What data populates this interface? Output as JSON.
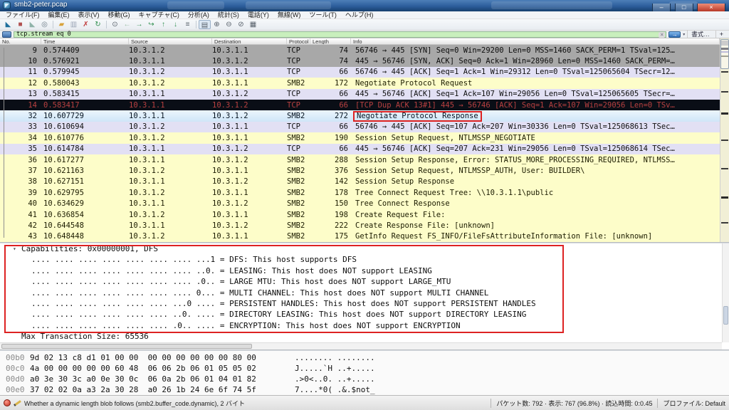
{
  "window": {
    "title": "smb2-peter.pcap",
    "controls": {
      "minimize": "–",
      "maximize": "□",
      "close": "×"
    }
  },
  "menu": {
    "items": [
      {
        "name": "file",
        "label": "ファイル(F)"
      },
      {
        "name": "edit",
        "label": "編集(E)"
      },
      {
        "name": "view",
        "label": "表示(V)"
      },
      {
        "name": "go",
        "label": "移動(G)"
      },
      {
        "name": "capture",
        "label": "キャプチャ(C)"
      },
      {
        "name": "analyze",
        "label": "分析(A)"
      },
      {
        "name": "statistics",
        "label": "統計(S)"
      },
      {
        "name": "telephony",
        "label": "電話(Y)"
      },
      {
        "name": "wireless",
        "label": "無線(W)"
      },
      {
        "name": "tools",
        "label": "ツール(T)"
      },
      {
        "name": "help",
        "label": "ヘルプ(H)"
      }
    ]
  },
  "toolbar": {
    "icons": [
      {
        "name": "start-capture",
        "glyph": "◣",
        "color": "#1e6f9c"
      },
      {
        "name": "stop-capture",
        "glyph": "■",
        "color": "#b05050"
      },
      {
        "name": "restart-capture",
        "glyph": "◣",
        "color": "#8fb3a9"
      },
      {
        "name": "capture-options",
        "glyph": "◎",
        "color": "#6a7a85"
      },
      {
        "sep": true
      },
      {
        "name": "open-file",
        "glyph": "▰",
        "color": "#d8a33c"
      },
      {
        "name": "save-file",
        "glyph": "▥",
        "color": "#9aa4b5"
      },
      {
        "name": "close-file",
        "glyph": "✗",
        "color": "#c03a3a"
      },
      {
        "name": "reload-file",
        "glyph": "↻",
        "color": "#2f8f4e"
      },
      {
        "sep": true
      },
      {
        "name": "find-packet",
        "glyph": "⊙",
        "color": "#57606a"
      },
      {
        "name": "go-back",
        "glyph": "←",
        "color": "#9fc0a8"
      },
      {
        "name": "go-forward",
        "glyph": "→",
        "color": "#2f8f4e"
      },
      {
        "name": "go-to-packet",
        "glyph": "↪",
        "color": "#2f8f4e"
      },
      {
        "name": "go-first",
        "glyph": "↑",
        "color": "#2f8f4e"
      },
      {
        "name": "go-last",
        "glyph": "↓",
        "color": "#2f8f4e"
      },
      {
        "name": "auto-scroll",
        "glyph": "≡",
        "color": "#57606a"
      },
      {
        "sep": true
      },
      {
        "name": "colorize",
        "glyph": "▤",
        "color": "#57606a",
        "framed": true
      },
      {
        "name": "zoom-in",
        "glyph": "⊕",
        "color": "#57606a"
      },
      {
        "name": "zoom-out",
        "glyph": "⊖",
        "color": "#57606a"
      },
      {
        "name": "zoom-100",
        "glyph": "⊘",
        "color": "#57606a"
      },
      {
        "name": "resize-columns",
        "glyph": "▦",
        "color": "#57606a"
      }
    ]
  },
  "filter": {
    "value": "tcp.stream eq 0",
    "clear_glyph": "×",
    "apply_glyph": "→",
    "caret_glyph": "▾",
    "expression_label": "書式…",
    "add_label": "+"
  },
  "packet_list": {
    "columns": [
      "No.",
      "Time",
      "Source",
      "Destination",
      "Protocol",
      "Length",
      "Info"
    ],
    "rows": [
      {
        "no": "9",
        "time": "0.574409",
        "src": "10.3.1.2",
        "dst": "10.3.1.1",
        "proto": "TCP",
        "len": "74",
        "info": "56746 → 445 [SYN] Seq=0 Win=29200 Len=0 MSS=1460 SACK_PERM=1 TSval=125…",
        "style": "gray"
      },
      {
        "no": "10",
        "time": "0.576921",
        "src": "10.3.1.1",
        "dst": "10.3.1.2",
        "proto": "TCP",
        "len": "74",
        "info": "445 → 56746 [SYN, ACK] Seq=0 Ack=1 Win=28960 Len=0 MSS=1460 SACK_PERM=…",
        "style": "gray"
      },
      {
        "no": "11",
        "time": "0.579945",
        "src": "10.3.1.2",
        "dst": "10.3.1.1",
        "proto": "TCP",
        "len": "66",
        "info": "56746 → 445 [ACK] Seq=1 Ack=1 Win=29312 Len=0 TSval=125065604 TSecr=12…",
        "style": "lavender"
      },
      {
        "no": "12",
        "time": "0.580043",
        "src": "10.3.1.2",
        "dst": "10.3.1.1",
        "proto": "SMB2",
        "len": "172",
        "info": "Negotiate Protocol Request",
        "style": "yellow"
      },
      {
        "no": "13",
        "time": "0.583415",
        "src": "10.3.1.1",
        "dst": "10.3.1.2",
        "proto": "TCP",
        "len": "66",
        "info": "445 → 56746 [ACK] Seq=1 Ack=107 Win=29056 Len=0 TSval=125065605 TSecr=…",
        "style": "lavender"
      },
      {
        "no": "14",
        "time": "0.583417",
        "src": "10.3.1.1",
        "dst": "10.3.1.2",
        "proto": "TCP",
        "len": "66",
        "info": "[TCP Dup ACK 13#1] 445 → 56746 [ACK] Seq=1 Ack=107 Win=29056 Len=0 TSv…",
        "style": "badtcp"
      },
      {
        "no": "32",
        "time": "10.607729",
        "src": "10.3.1.1",
        "dst": "10.3.1.2",
        "proto": "SMB2",
        "len": "272",
        "info": "Negotiate Protocol Response",
        "style": "selected",
        "boxed": true
      },
      {
        "no": "33",
        "time": "10.610694",
        "src": "10.3.1.2",
        "dst": "10.3.1.1",
        "proto": "TCP",
        "len": "66",
        "info": "56746 → 445 [ACK] Seq=107 Ack=207 Win=30336 Len=0 TSval=125068613 TSec…",
        "style": "lavender"
      },
      {
        "no": "34",
        "time": "10.610776",
        "src": "10.3.1.2",
        "dst": "10.3.1.1",
        "proto": "SMB2",
        "len": "190",
        "info": "Session Setup Request, NTLMSSP_NEGOTIATE",
        "style": "yellow"
      },
      {
        "no": "35",
        "time": "10.614784",
        "src": "10.3.1.1",
        "dst": "10.3.1.2",
        "proto": "TCP",
        "len": "66",
        "info": "445 → 56746 [ACK] Seq=207 Ack=231 Win=29056 Len=0 TSval=125068614 TSec…",
        "style": "lavender"
      },
      {
        "no": "36",
        "time": "10.617277",
        "src": "10.3.1.1",
        "dst": "10.3.1.2",
        "proto": "SMB2",
        "len": "288",
        "info": "Session Setup Response, Error: STATUS_MORE_PROCESSING_REQUIRED, NTLMSS…",
        "style": "yellow"
      },
      {
        "no": "37",
        "time": "10.621163",
        "src": "10.3.1.2",
        "dst": "10.3.1.1",
        "proto": "SMB2",
        "len": "376",
        "info": "Session Setup Request, NTLMSSP_AUTH, User: BUILDER\\",
        "style": "yellow"
      },
      {
        "no": "38",
        "time": "10.627151",
        "src": "10.3.1.1",
        "dst": "10.3.1.2",
        "proto": "SMB2",
        "len": "142",
        "info": "Session Setup Response",
        "style": "yellow"
      },
      {
        "no": "39",
        "time": "10.629795",
        "src": "10.3.1.2",
        "dst": "10.3.1.1",
        "proto": "SMB2",
        "len": "178",
        "info": "Tree Connect Request Tree: \\\\10.3.1.1\\public",
        "style": "yellow"
      },
      {
        "no": "40",
        "time": "10.634629",
        "src": "10.3.1.1",
        "dst": "10.3.1.2",
        "proto": "SMB2",
        "len": "150",
        "info": "Tree Connect Response",
        "style": "yellow"
      },
      {
        "no": "41",
        "time": "10.636854",
        "src": "10.3.1.2",
        "dst": "10.3.1.1",
        "proto": "SMB2",
        "len": "198",
        "info": "Create Request File:",
        "style": "yellow"
      },
      {
        "no": "42",
        "time": "10.644548",
        "src": "10.3.1.1",
        "dst": "10.3.1.2",
        "proto": "SMB2",
        "len": "222",
        "info": "Create Response File: [unknown]",
        "style": "yellow"
      },
      {
        "no": "43",
        "time": "10.648448",
        "src": "10.3.1.2",
        "dst": "10.3.1.1",
        "proto": "SMB2",
        "len": "175",
        "info": "GetInfo Request FS_INFO/FileFsAttributeInformation File: [unknown]",
        "style": "yellow"
      }
    ]
  },
  "details": {
    "expander_glyph": "▾",
    "capabilities_header": "Capabilities: 0x00000001, DFS",
    "flags": [
      ".... .... .... .... .... .... .... ...1 = DFS: This host supports DFS",
      ".... .... .... .... .... .... .... ..0. = LEASING: This host does NOT support LEASING",
      ".... .... .... .... .... .... .... .0.. = LARGE MTU: This host does NOT support LARGE_MTU",
      ".... .... .... .... .... .... .... 0... = MULTI CHANNEL: This host does NOT support MULTI CHANNEL",
      ".... .... .... .... .... .... ...0 .... = PERSISTENT HANDLES: This host does NOT support PERSISTENT HANDLES",
      ".... .... .... .... .... .... ..0. .... = DIRECTORY LEASING: This host does NOT support DIRECTORY LEASING",
      ".... .... .... .... .... .... .0.. .... = ENCRYPTION: This host does NOT support ENCRYPTION"
    ],
    "max_transaction": "Max Transaction Size: 65536"
  },
  "hex": {
    "rows": [
      {
        "offset": "00b0",
        "bytes": "9d 02 13 c8 d1 01 00 00  00 00 00 00 00 00 80 00",
        "ascii": "........ ........"
      },
      {
        "offset": "00c0",
        "bytes": "4a 00 00 00 00 00 60 48  06 06 2b 06 01 05 05 02",
        "ascii": "J.....`H ..+....."
      },
      {
        "offset": "00d0",
        "bytes": "a0 3e 30 3c a0 0e 30 0c  06 0a 2b 06 01 04 01 82",
        "ascii": ".>0<..0. ..+....."
      },
      {
        "offset": "00e0",
        "bytes": "37 02 02 0a a3 2a 30 28  a0 26 1b 24 6e 6f 74 5f",
        "ascii": "7....*0( .&.$not_"
      }
    ]
  },
  "statusbar": {
    "field_info": "Whether a dynamic length blob follows (smb2.buffer_code.dynamic), 2 バイト",
    "packets_info": "パケット数: 792 · 表示: 767 (96.8%) · 読込時間: 0:0.45",
    "profile": "プロファイル: Default"
  },
  "colors": {
    "annotation_red": "#dd2222",
    "filter_green": "#c9efbd",
    "smb2_row": "#fdfdc9",
    "tcp_row": "#e2e0f4",
    "gray_row": "#a8a8a8",
    "bad_tcp_bg": "#0a0e16",
    "bad_tcp_fg": "#b84040",
    "selected_row": "#cfe6f8",
    "titlebar_blue": "#2c5d9b"
  }
}
